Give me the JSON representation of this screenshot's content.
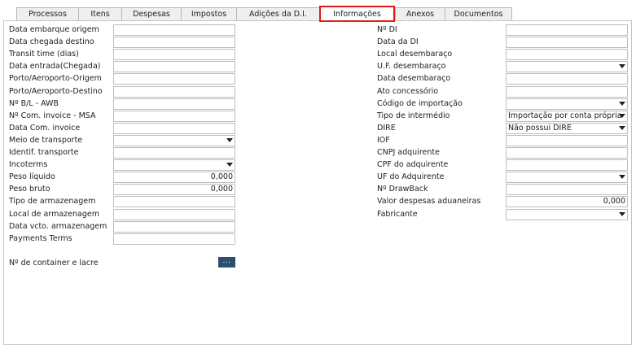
{
  "tabs": [
    "Processos",
    "Itens",
    "Despesas",
    "Impostos",
    "Adições da D.I.",
    "Informações",
    "Anexos",
    "Documentos"
  ],
  "left_fields": [
    {
      "label": "Data embarque origem",
      "value": "",
      "type": "text"
    },
    {
      "label": "Data chegada destino",
      "value": "",
      "type": "text"
    },
    {
      "label": "Transit time (dias)",
      "value": "",
      "type": "text"
    },
    {
      "label": "Data entrada(Chegada)",
      "value": "",
      "type": "text"
    },
    {
      "label": "Porto/Aeroporto-Origem",
      "value": "",
      "type": "text"
    },
    {
      "label": "Porto/Aeroporto-Destino",
      "value": "",
      "type": "text"
    },
    {
      "label": "Nº B/L - AWB",
      "value": "",
      "type": "text"
    },
    {
      "label": "Nº Com. invoice - MSA",
      "value": "",
      "type": "text"
    },
    {
      "label": "Data Com. invoice",
      "value": "",
      "type": "text"
    },
    {
      "label": "Meio de transporte",
      "value": "",
      "type": "select"
    },
    {
      "label": "Identif. transporte",
      "value": "",
      "type": "text"
    },
    {
      "label": "Incoterms",
      "value": "",
      "type": "select"
    },
    {
      "label": "Peso líquido",
      "value": "0,000",
      "type": "number"
    },
    {
      "label": "Peso bruto",
      "value": "0,000",
      "type": "number"
    },
    {
      "label": "Tipo de armazenagem",
      "value": "",
      "type": "text"
    },
    {
      "label": "Local de armazenagem",
      "value": "",
      "type": "text"
    },
    {
      "label": "Data vcto. armazenagem",
      "value": "",
      "type": "text"
    },
    {
      "label": "Payments Terms",
      "value": "",
      "type": "text"
    }
  ],
  "container": {
    "label": "Nº de container e lacre",
    "button": "..."
  },
  "right_fields": [
    {
      "label": "Nº DI",
      "value": "",
      "type": "text"
    },
    {
      "label": "Data da DI",
      "value": "",
      "type": "text"
    },
    {
      "label": "Local desembaraço",
      "value": "",
      "type": "text"
    },
    {
      "label": "U.F. desembaraço",
      "value": "",
      "type": "select"
    },
    {
      "label": "Data desembaraço",
      "value": "",
      "type": "text"
    },
    {
      "label": "Ato concessório",
      "value": "",
      "type": "text"
    },
    {
      "label": "Código de importação",
      "value": "",
      "type": "select"
    },
    {
      "label": "Tipo de intermédio",
      "value": "Importação por conta própria",
      "type": "select"
    },
    {
      "label": "DIRE",
      "value": "Não possui DIRE",
      "type": "select"
    },
    {
      "label": "IOF",
      "value": "",
      "type": "text"
    },
    {
      "label": "CNPJ adquirente",
      "value": "",
      "type": "text"
    },
    {
      "label": "CPF do adquirente",
      "value": "",
      "type": "text"
    },
    {
      "label": "UF do Adquirente",
      "value": "",
      "type": "select"
    },
    {
      "label": "Nº DrawBack",
      "value": "",
      "type": "text"
    },
    {
      "label": "Valor despesas aduaneiras",
      "value": "0,000",
      "type": "number"
    },
    {
      "label": "Fabricante",
      "value": "",
      "type": "select"
    }
  ]
}
